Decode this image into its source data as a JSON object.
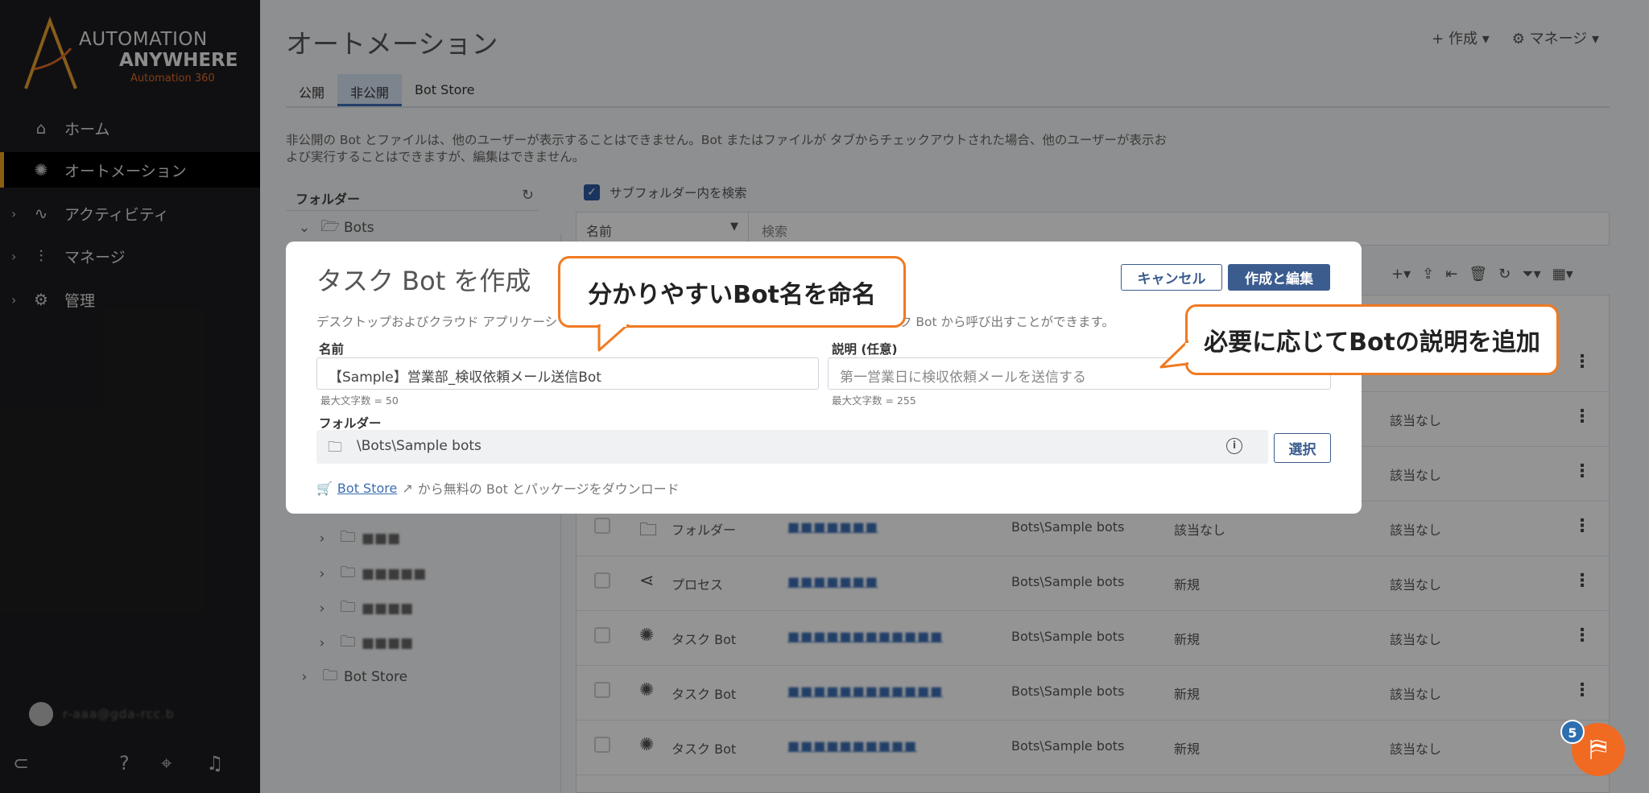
{
  "app": {
    "brand_line1": "AUTOMATION",
    "brand_line2": "ANYWHERE",
    "brand_line3": "Automation 360",
    "brand_color": "#e06a2a"
  },
  "sidebar": {
    "items": [
      {
        "label": "ホーム",
        "icon": "home-icon"
      },
      {
        "label": "オートメーション",
        "icon": "automation-icon",
        "active": true
      },
      {
        "label": "アクティビティ",
        "icon": "activity-icon"
      },
      {
        "label": "マネージ",
        "icon": "manage-icon"
      },
      {
        "label": "管理",
        "icon": "settings-icon"
      }
    ],
    "user_name": "r-aaa@gda-rcc.b"
  },
  "header": {
    "title": "オートメーション",
    "create_label": "+ 作成 ▾",
    "manage_label": "⚙ マネージ ▾"
  },
  "tabs": [
    {
      "label": "公開"
    },
    {
      "label": "非公開",
      "active": true
    },
    {
      "label": "Bot Store"
    }
  ],
  "description": "非公開の Bot とファイルは、他のユーザーが表示することはできません。Bot またはファイルが タブからチェックアウトされた場合、他のユーザーが表示および実行することはできますが、編集はできません。",
  "folders": {
    "header": "フォルダー",
    "items": [
      {
        "label": "Bots"
      },
      {
        "label": "■■■"
      },
      {
        "label": "■■■■■"
      },
      {
        "label": "■■■■"
      },
      {
        "label": "■■■■"
      },
      {
        "label": "Bot Store"
      }
    ]
  },
  "search": {
    "subfolder_label": "サブフォルダー内を検索",
    "field_label": "名前",
    "placeholder": "検索"
  },
  "table": {
    "rows": [
      {
        "type": "",
        "name": "",
        "path": "",
        "status": "",
        "dependency": ""
      },
      {
        "type": "",
        "name": "",
        "path": "",
        "status": "",
        "dependency": "該当なし"
      },
      {
        "type": "",
        "name": "",
        "path": "",
        "status": "",
        "dependency": "該当なし"
      },
      {
        "type": "フォルダー",
        "name": "■■■■■■■",
        "path": "Bots\\Sample bots",
        "status": "該当なし",
        "dependency": "該当なし"
      },
      {
        "type": "プロセス",
        "name": "■■■■■■■",
        "path": "Bots\\Sample bots",
        "status": "新規",
        "dependency": "該当なし"
      },
      {
        "type": "タスク Bot",
        "name": "■■■■■■■■■■■■",
        "path": "Bots\\Sample bots",
        "status": "新規",
        "dependency": "該当なし"
      },
      {
        "type": "タスク Bot",
        "name": "■■■■■■■■■■■■",
        "path": "Bots\\Sample bots",
        "status": "新規",
        "dependency": "該当なし"
      },
      {
        "type": "タスク Bot",
        "name": "■■■■■■■■■■",
        "path": "Bots\\Sample bots",
        "status": "新規",
        "dependency": "該当なし"
      }
    ]
  },
  "modal": {
    "title": "タスク Bot を作成",
    "cancel_label": "キャンセル",
    "create_label": "作成と編集",
    "desc_left": "デスクトップおよびクラウド アプリケーシ",
    "desc_right": "ク Bot から呼び出すことができます。",
    "name_label": "名前",
    "name_value": "【Sample】営業部_検収依頼メール送信Bot",
    "name_hint": "最大文字数 = 50",
    "desc_label": "説明 (任意)",
    "desc_value": "第一営業日に検収依頼メールを送信する",
    "desc_hint": "最大文字数 = 255",
    "folder_label": "フォルダー",
    "folder_value": "\\Bots\\Sample bots",
    "select_label": "選択",
    "store_link": "Bot Store",
    "store_text": "から無料の Bot とパッケージをダウンロード"
  },
  "callouts": {
    "name_tip": "分かりやすいBot名を命名",
    "desc_tip": "必要に応じてBotの説明を追加",
    "color": "#f07a22"
  },
  "help": {
    "badge": "5"
  }
}
